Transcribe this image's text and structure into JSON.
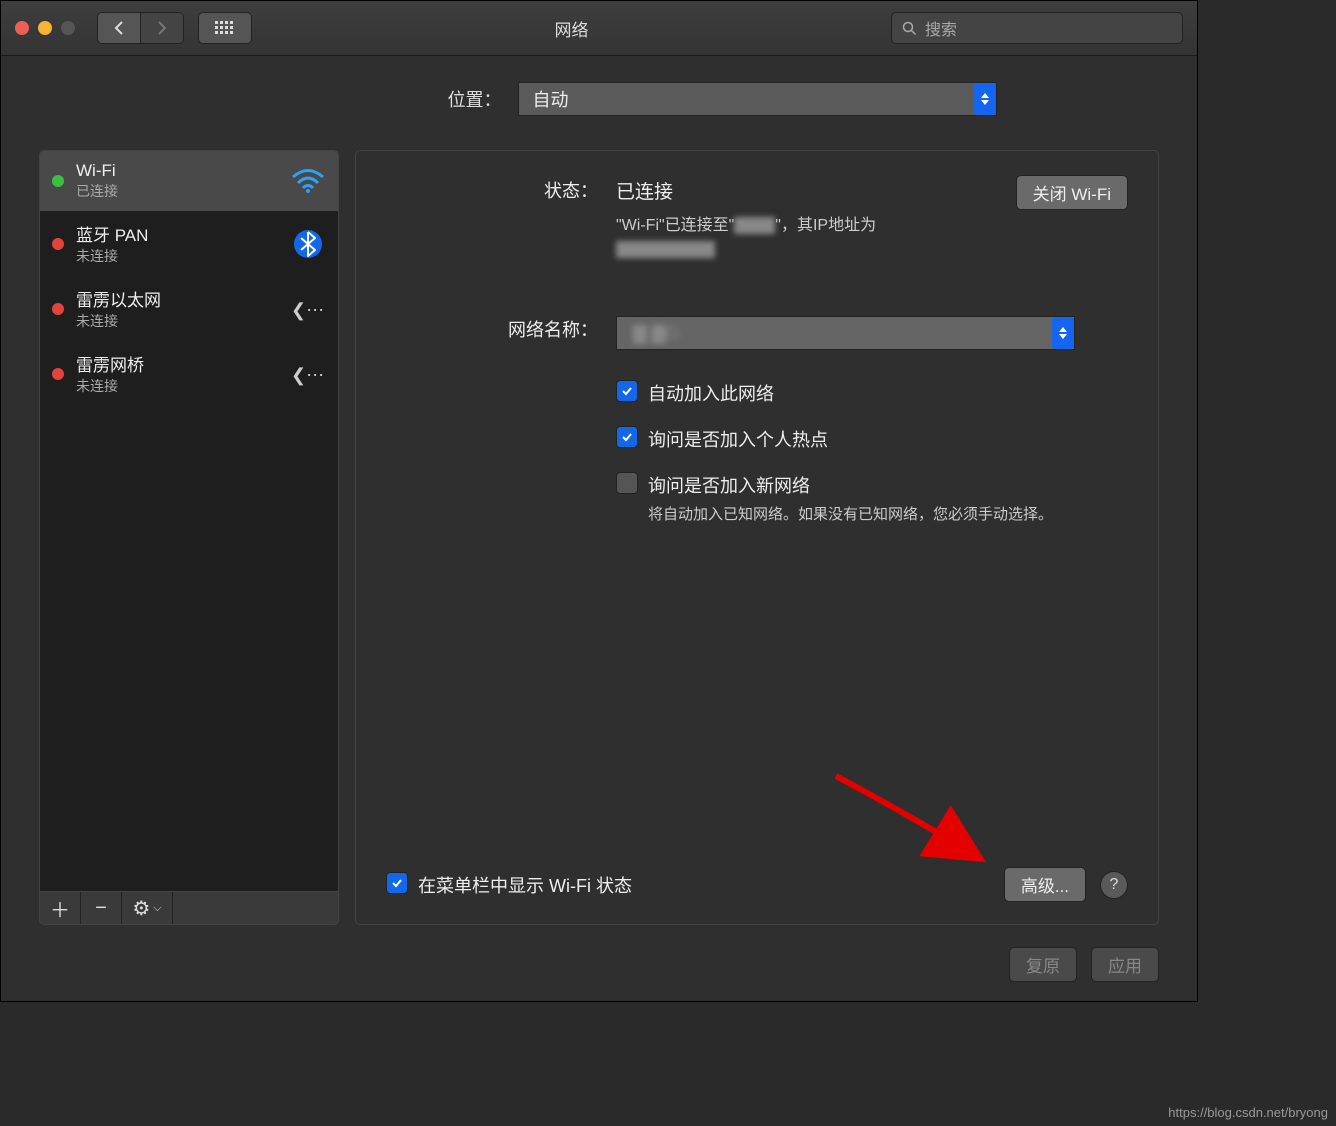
{
  "window": {
    "title": "网络",
    "search_placeholder": "搜索"
  },
  "location": {
    "label": "位置：",
    "value": "自动"
  },
  "sidebar": {
    "items": [
      {
        "name": "Wi-Fi",
        "status": "已连接",
        "dot": "green",
        "icon": "wifi"
      },
      {
        "name": "蓝牙 PAN",
        "status": "未连接",
        "dot": "red",
        "icon": "bluetooth"
      },
      {
        "name": "雷雳以太网",
        "status": "未连接",
        "dot": "red",
        "icon": "thunderbolt"
      },
      {
        "name": "雷雳网桥",
        "status": "未连接",
        "dot": "red",
        "icon": "thunderbolt"
      }
    ]
  },
  "detail": {
    "status_label": "状态：",
    "status_value": "已连接",
    "close_wifi_btn": "关闭 Wi-Fi",
    "status_text_prefix": "\"Wi-Fi\"已连接至\"",
    "status_text_ssid_hidden": "▇▇▇",
    "status_text_mid": "\"，其IP地址为",
    "status_text_ip_hidden": "▇▇▇.▇.▇4。",
    "network_name_label": "网络名称：",
    "network_name_value": "▇  ▇G",
    "auto_join": "自动加入此网络",
    "ask_hotspot": "询问是否加入个人热点",
    "ask_new": "询问是否加入新网络",
    "ask_new_help": "将自动加入已知网络。如果没有已知网络，您必须手动选择。",
    "show_in_menubar": "在菜单栏中显示 Wi-Fi 状态",
    "advanced_btn": "高级..."
  },
  "footer": {
    "revert": "复原",
    "apply": "应用"
  },
  "watermark": "https://blog.csdn.net/bryong"
}
